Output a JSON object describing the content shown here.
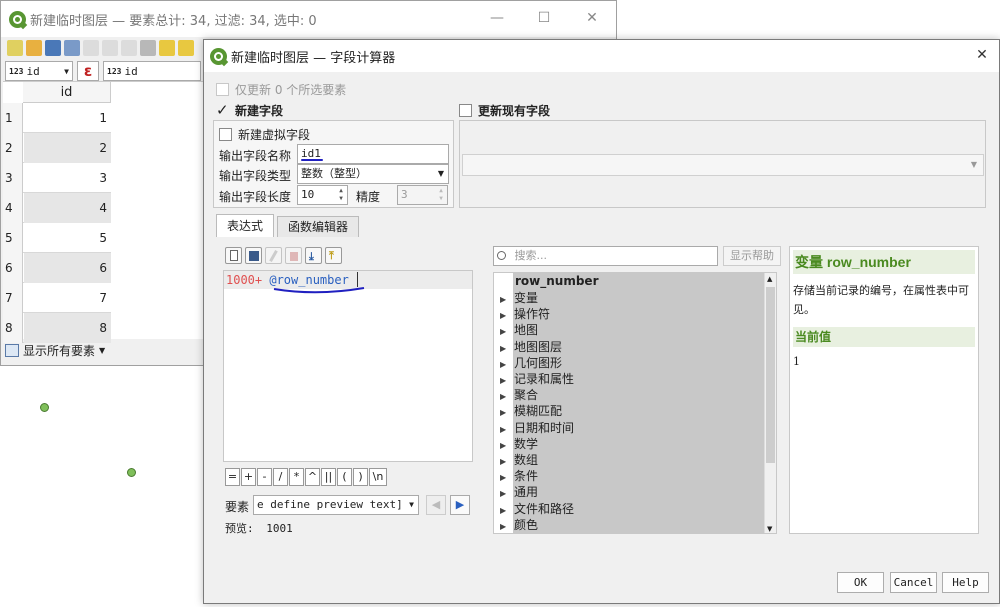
{
  "background_window": {
    "title": "新建临时图层 — 要素总计: 34, 过滤: 34, 选中: 0",
    "field_combo": "id",
    "field_type": "123",
    "expr_combo": "id",
    "expr_type": "123",
    "column_header": "id",
    "rows": [
      {
        "n": "1",
        "v": "1"
      },
      {
        "n": "2",
        "v": "2"
      },
      {
        "n": "3",
        "v": "3"
      },
      {
        "n": "4",
        "v": "4"
      },
      {
        "n": "5",
        "v": "5"
      },
      {
        "n": "6",
        "v": "6"
      },
      {
        "n": "7",
        "v": "7"
      },
      {
        "n": "8",
        "v": "8"
      }
    ],
    "show_all": "显示所有要素"
  },
  "dialog": {
    "title": "新建临时图层 — 字段计算器",
    "only_update": "仅更新 0 个所选要素",
    "new_field": "新建字段",
    "update_existing": "更新现有字段",
    "virtual_field": "新建虚拟字段",
    "out_name_label": "输出字段名称",
    "out_name_value": "id1",
    "out_type_label": "输出字段类型",
    "out_type_value": "整数（整型）",
    "out_len_label": "输出字段长度",
    "out_len_value": "10",
    "precision_label": "精度",
    "precision_value": "3",
    "tab_expression": "表达式",
    "tab_function_editor": "函数编辑器",
    "expr_num": "1000+",
    "expr_var": "@row_number",
    "ops": [
      "=",
      "+",
      "-",
      "/",
      "*",
      "^",
      "||",
      "(",
      ")",
      "\\n"
    ],
    "feature_label": "要素",
    "feature_value": "e define preview text]",
    "preview_label": "预览:",
    "preview_value": "1001",
    "search_placeholder": "搜索...",
    "show_help": "显示帮助",
    "tree_top": "row_number",
    "tree_items": [
      "变量",
      "操作符",
      "地图",
      "地图图层",
      "几何图形",
      "记录和属性",
      "聚合",
      "模糊匹配",
      "日期和时间",
      "数学",
      "数组",
      "条件",
      "通用",
      "文件和路径",
      "颜色"
    ],
    "help_title_prefix": "变量",
    "help_title_name": "row_number",
    "help_desc": "存储当前记录的编号，在属性表中可见。",
    "current_value_label": "当前值",
    "current_value": "1",
    "ok": "OK",
    "cancel": "Cancel",
    "help": "Help"
  }
}
